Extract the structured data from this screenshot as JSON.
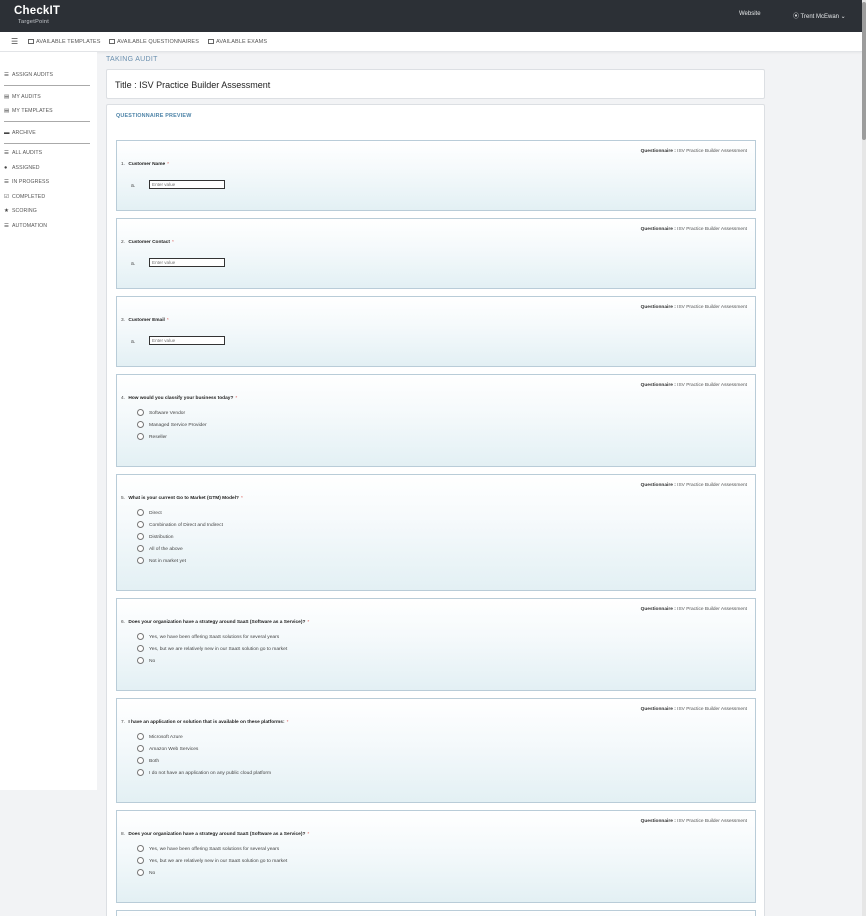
{
  "header": {
    "brand_name": "CheckIT",
    "brand_sub": "TargetPoint",
    "website_link": "Website",
    "user_menu": "⦿ Trent McEwan ⌄"
  },
  "subnav": {
    "items": [
      "AVAILABLE TEMPLATES",
      "AVAILABLE QUESTIONNAIRES",
      "AVAILABLE EXAMS"
    ]
  },
  "sidebar": {
    "items": [
      {
        "label": "ASSIGN AUDITS",
        "icon": "list-icon",
        "sym": "☰"
      },
      {
        "label": "MY AUDITS",
        "icon": "card-icon",
        "sym": "▤"
      },
      {
        "label": "MY TEMPLATES",
        "icon": "template-icon",
        "sym": "▤"
      },
      {
        "label": "ARCHIVE",
        "icon": "archive-icon",
        "sym": "▬"
      },
      {
        "label": "ALL AUDITS",
        "icon": "list-icon",
        "sym": "☰"
      },
      {
        "label": "ASSIGNED",
        "icon": "pin-icon",
        "sym": "●"
      },
      {
        "label": "IN PROGRESS",
        "icon": "list-icon",
        "sym": "☰"
      },
      {
        "label": "COMPLETED",
        "icon": "check-icon",
        "sym": "☑"
      },
      {
        "label": "SCORING",
        "icon": "star-icon",
        "sym": "★"
      },
      {
        "label": "AUTOMATION",
        "icon": "list-icon",
        "sym": "☰"
      }
    ]
  },
  "main": {
    "section_title": "TAKING AUDIT",
    "audit_title": "Title : ISV Practice Builder Assessment",
    "preview_label": "QUESTIONNAIRE PREVIEW",
    "questionnaire_label": "Questionnaire :",
    "questionnaire_name": "ISV Practice Builder Assessment",
    "questions": [
      {
        "num": "1.",
        "text": "Customer Name",
        "bullet": "a.",
        "placeholder": "Enter value"
      },
      {
        "num": "2.",
        "text": "Customer Contact",
        "bullet": "a.",
        "placeholder": "Enter value"
      },
      {
        "num": "3.",
        "text": "Customer Email",
        "bullet": "a.",
        "placeholder": "Enter value"
      },
      {
        "num": "4.",
        "text": "How would you classify your business today?",
        "options": [
          "Software Vendor",
          "Managed Service Provider",
          "Reseller"
        ]
      },
      {
        "num": "5.",
        "text": "What is your current Go to Market (GTM) Model?",
        "options": [
          "Direct",
          "Combination of Direct and Indirect",
          "Distribution",
          "All of the above",
          "Not in market yet"
        ]
      },
      {
        "num": "6.",
        "text": "Does your organization have a strategy around SaaS (Software as a Service)?",
        "options": [
          "Yes, we have been offering SaaS solutions for several years",
          "Yes, but we are relatively new in our SaaS solution go to market",
          "No"
        ]
      },
      {
        "num": "7.",
        "text": "I have an application or solution that is available on these platforms:",
        "options": [
          "Microsoft Azure",
          "Amazon Web Services",
          "Both",
          "I do not have an application on any public cloud platform"
        ]
      },
      {
        "num": "8.",
        "text": "Does your organization have a strategy around SaaS (Software as a Service)?",
        "options": [
          "Yes, we have been offering SaaS solutions for several years",
          "Yes, but we are relatively new in our SaaS solution go to market",
          "No"
        ]
      }
    ],
    "required_mark": "*"
  }
}
